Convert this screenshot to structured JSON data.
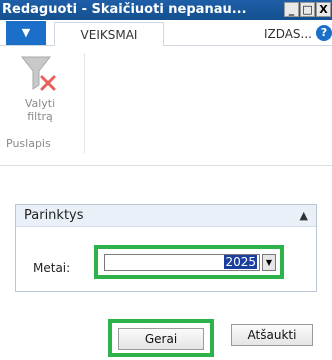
{
  "window": {
    "title": "Redaguoti - Skaičiuoti nepanau...",
    "buttons": {
      "minimize": "_",
      "maximize": "□",
      "close": "X"
    }
  },
  "tabs": {
    "menu_icon": "▼",
    "active": "VEIKSMAI",
    "more": "IZDAS...",
    "help": "?"
  },
  "ribbon": {
    "filter_button": {
      "label": "Valyti filtrą",
      "icon": "clear-filter-icon"
    },
    "group_label": "Puslapis"
  },
  "options": {
    "header": "Parinktys",
    "collapse_icon": "▲",
    "year_label": "Metai:",
    "year_value": "2025",
    "dropdown_icon": "▼"
  },
  "actions": {
    "ok_label": "Gerai",
    "cancel_label": "Atšaukti"
  },
  "colors": {
    "titlebar": "#1f5fa8",
    "accent": "#1b6fc8",
    "highlight": "#2db34a"
  }
}
